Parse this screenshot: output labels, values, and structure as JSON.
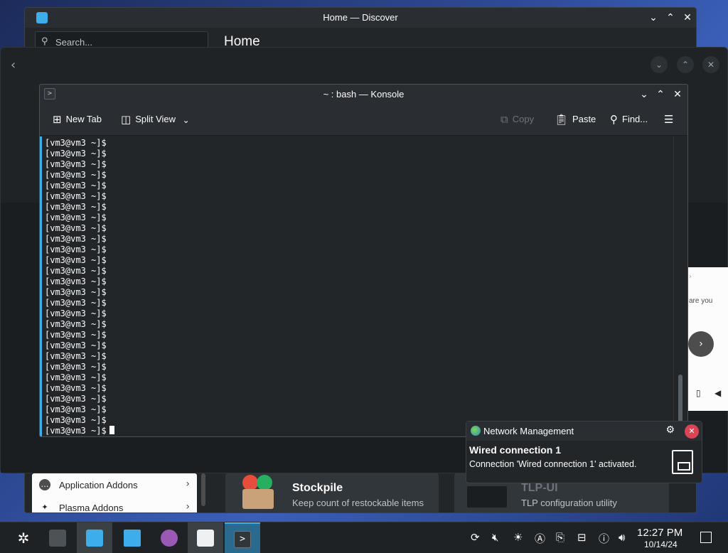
{
  "discover": {
    "title": "Home — Discover",
    "search_placeholder": "Search...",
    "page_title": "Home",
    "addons": [
      {
        "label": "Application Addons"
      },
      {
        "label": "Plasma Addons"
      }
    ],
    "cards": [
      {
        "name": "Stockpile",
        "desc": "Keep count of restockable items"
      },
      {
        "name": "TLP-UI",
        "desc": "TLP configuration utility"
      }
    ]
  },
  "peek": {
    "text": "are you"
  },
  "konsole": {
    "title": "~ : bash — Konsole",
    "toolbar": {
      "new_tab": "New Tab",
      "split_view": "Split View",
      "copy": "Copy",
      "paste": "Paste",
      "find": "Find..."
    },
    "prompt": "[vm3@vm3 ~]$",
    "lines": [
      "[vm3@vm3 ~]$",
      "[vm3@vm3 ~]$",
      "[vm3@vm3 ~]$",
      "[vm3@vm3 ~]$",
      "[vm3@vm3 ~]$",
      "[vm3@vm3 ~]$",
      "[vm3@vm3 ~]$",
      "[vm3@vm3 ~]$",
      "[vm3@vm3 ~]$",
      "[vm3@vm3 ~]$",
      "[vm3@vm3 ~]$",
      "[vm3@vm3 ~]$",
      "[vm3@vm3 ~]$",
      "[vm3@vm3 ~]$",
      "[vm3@vm3 ~]$",
      "[vm3@vm3 ~]$",
      "[vm3@vm3 ~]$",
      "[vm3@vm3 ~]$",
      "[vm3@vm3 ~]$",
      "[vm3@vm3 ~]$",
      "[vm3@vm3 ~]$",
      "[vm3@vm3 ~]$",
      "[vm3@vm3 ~]$",
      "[vm3@vm3 ~]$",
      "[vm3@vm3 ~]$",
      "[vm3@vm3 ~]$",
      "[vm3@vm3 ~]$",
      "[vm3@vm3 ~]$"
    ]
  },
  "notification": {
    "app_name": "Network Management",
    "summary": "Wired connection 1",
    "body": "Connection 'Wired connection 1' activated."
  },
  "taskbar": {
    "time": "12:27 PM",
    "date": "10/14/24",
    "apps": [
      "app-launcher-icon",
      "system-settings-icon",
      "discover-icon",
      "dolphin-icon",
      "browser-icon",
      "store-icon",
      "konsole-icon"
    ],
    "tray": [
      "updates-icon",
      "volume-mute-icon",
      "brightness-icon",
      "input-method-icon",
      "clipboard-icon",
      "network-wired-icon",
      "help-icon",
      "volume-icon",
      "expand-tray-icon"
    ]
  },
  "colors": {
    "accent": "#3daee9",
    "window_bg": "#232629",
    "close_red": "#da4453"
  }
}
